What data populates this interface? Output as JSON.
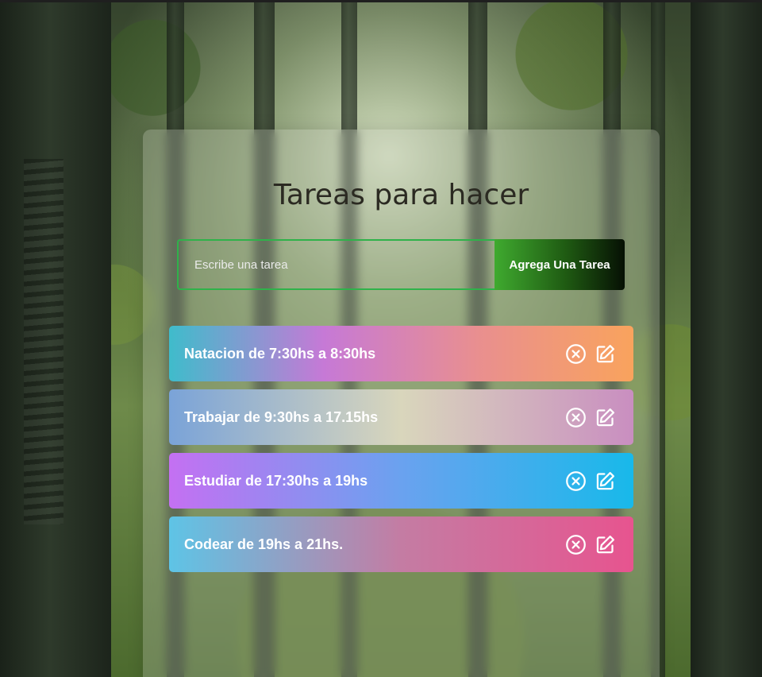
{
  "header": {
    "title": "Tareas para hacer"
  },
  "form": {
    "input_placeholder": "Escribe una tarea",
    "input_value": "",
    "add_button_label": "Agrega Una Tarea"
  },
  "tasks": [
    {
      "text": "Natacion de 7:30hs a 8:30hs",
      "gradient": [
        "#3fbccb",
        "#c679d6",
        "#e98f8f",
        "#f9a35d"
      ]
    },
    {
      "text": "Trabajar de 9:30hs a 17.15hs",
      "gradient": [
        "#7aa3d8",
        "#d9d6bc",
        "#c98ec0"
      ]
    },
    {
      "text": "Estudiar de 17:30hs a 19hs",
      "gradient": [
        "#c470f2",
        "#6aa2ef",
        "#18b9ea"
      ]
    },
    {
      "text": "Codear de 19hs a 21hs.",
      "gradient": [
        "#5ec4e6",
        "#c47ca3",
        "#e7548f"
      ]
    }
  ],
  "icons": {
    "delete": "close-circle-icon",
    "edit": "edit-icon"
  },
  "colors": {
    "input_border": "#2fb24a",
    "button_gradient_start": "#3faa2f",
    "button_gradient_end": "#061004",
    "title_color": "#2b2a22"
  }
}
